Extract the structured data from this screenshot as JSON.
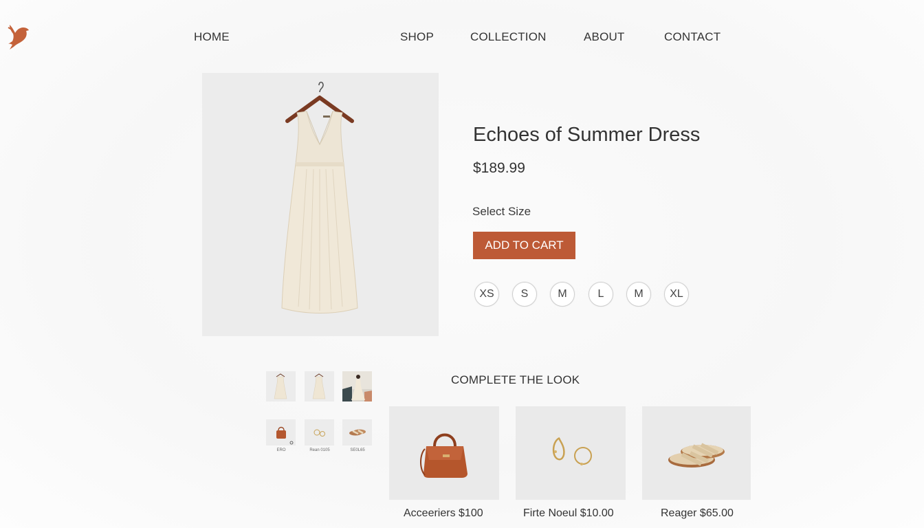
{
  "brand": {
    "logo_icon": "bird-icon",
    "accent_color": "#bd5a36"
  },
  "nav": [
    {
      "label": "HOME"
    },
    {
      "label": "SHOP"
    },
    {
      "label": "COLLECTION"
    },
    {
      "label": "ABOUT"
    },
    {
      "label": "CONTACT"
    }
  ],
  "product": {
    "title": "Echoes of Summer Dress",
    "price": "$189.99",
    "select_size_label": "Select Size",
    "add_to_cart_label": "ADD TO CART",
    "zoom_icon": "magnifier-icon",
    "sizes": [
      "XS",
      "S",
      "M",
      "L",
      "M",
      "XL"
    ]
  },
  "thumbnails": [
    {
      "subject": "dress-front"
    },
    {
      "subject": "dress-back"
    },
    {
      "subject": "dress-on-model"
    },
    {
      "subject": "handbag",
      "caption": "ERO"
    },
    {
      "subject": "earrings",
      "caption": "Rean 0105"
    },
    {
      "subject": "sandals",
      "caption": "SE0L65"
    }
  ],
  "complete_the_look": {
    "heading": "COMPLETE THE LOOK",
    "items": [
      {
        "subject": "handbag",
        "caption": "Acceeriers $100"
      },
      {
        "subject": "earrings",
        "caption": "Firte Noeul $10.00"
      },
      {
        "subject": "sandals",
        "caption": "Reager $65.00"
      }
    ]
  }
}
